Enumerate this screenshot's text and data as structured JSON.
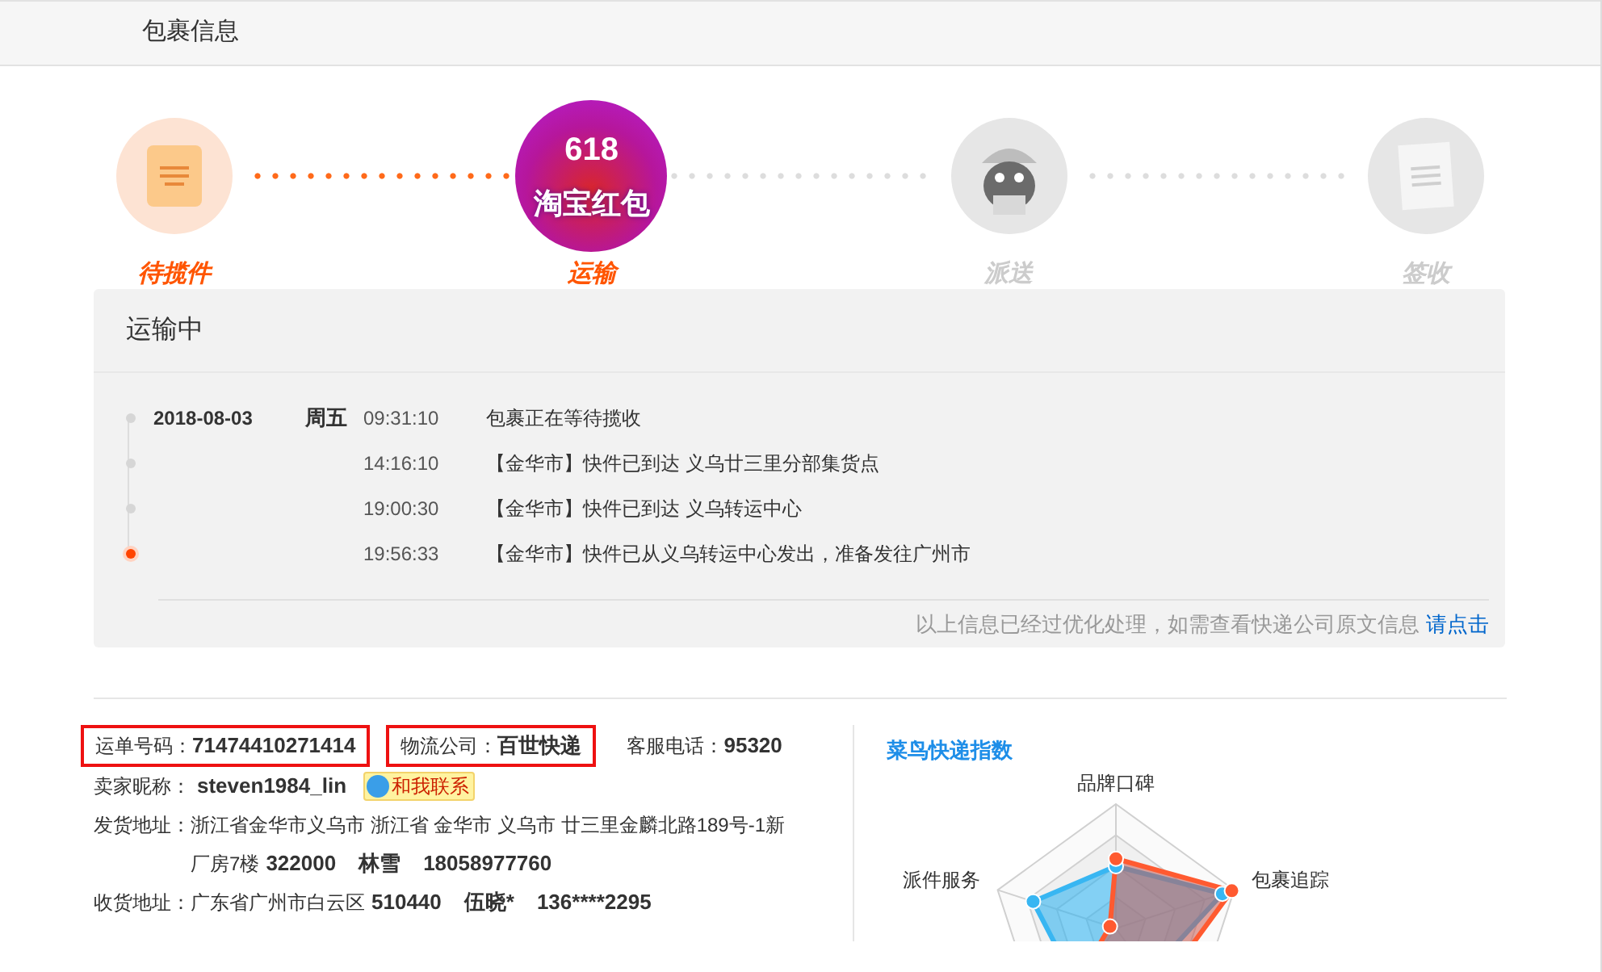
{
  "header": {
    "title": "包裹信息"
  },
  "steps": [
    {
      "label": "待揽件",
      "active": true,
      "kind": "parcel"
    },
    {
      "label": "运输",
      "active": true,
      "kind": "promo",
      "badge_number": "618",
      "badge_text": "淘宝红包"
    },
    {
      "label": "派送",
      "active": false,
      "kind": "courier"
    },
    {
      "label": "签收",
      "active": false,
      "kind": "receipt"
    }
  ],
  "tracking": {
    "status": "运输中",
    "events": [
      {
        "date": "2018-08-03",
        "weekday": "周五",
        "time": "09:31:10",
        "text": "包裹正在等待揽收",
        "current": false
      },
      {
        "time": "14:16:10",
        "text": "【金华市】快件已到达 义乌廿三里分部集货点",
        "current": false
      },
      {
        "time": "19:00:30",
        "text": "【金华市】快件已到达 义乌转运中心",
        "current": false
      },
      {
        "time": "19:56:33",
        "text": "【金华市】快件已从义乌转运中心发出，准备发往广州市",
        "current": true
      }
    ],
    "note": "以上信息已经过优化处理，如需查看快递公司原文信息",
    "note_link": "请点击"
  },
  "info": {
    "fields": [
      {
        "label": "运单号码：",
        "value": "71474410271414",
        "highlighted": true
      },
      {
        "label": "物流公司：",
        "value": "百世快递",
        "highlighted": true
      },
      {
        "label": "客服电话：",
        "value": "95320",
        "highlighted": false
      }
    ],
    "seller": {
      "label": "卖家昵称：",
      "value": "steven1984_lin",
      "contact": "和我联系"
    },
    "sender": {
      "label": "发货地址：",
      "address": "浙江省金华市义乌市 浙江省 金华市 义乌市 廿三里金麟北路189号-1新厂房7楼",
      "postcode": "322000",
      "name": "林雪",
      "phone": "18058977760"
    },
    "receiver": {
      "label": "收货地址：",
      "address": "广东省广州市白云区",
      "postcode": "510440",
      "name": "伍晓*",
      "phone": "136****2295"
    }
  },
  "index": {
    "title": "菜鸟快递指数",
    "axes": [
      "品牌口碑",
      "包裹追踪",
      "派件服务"
    ]
  }
}
